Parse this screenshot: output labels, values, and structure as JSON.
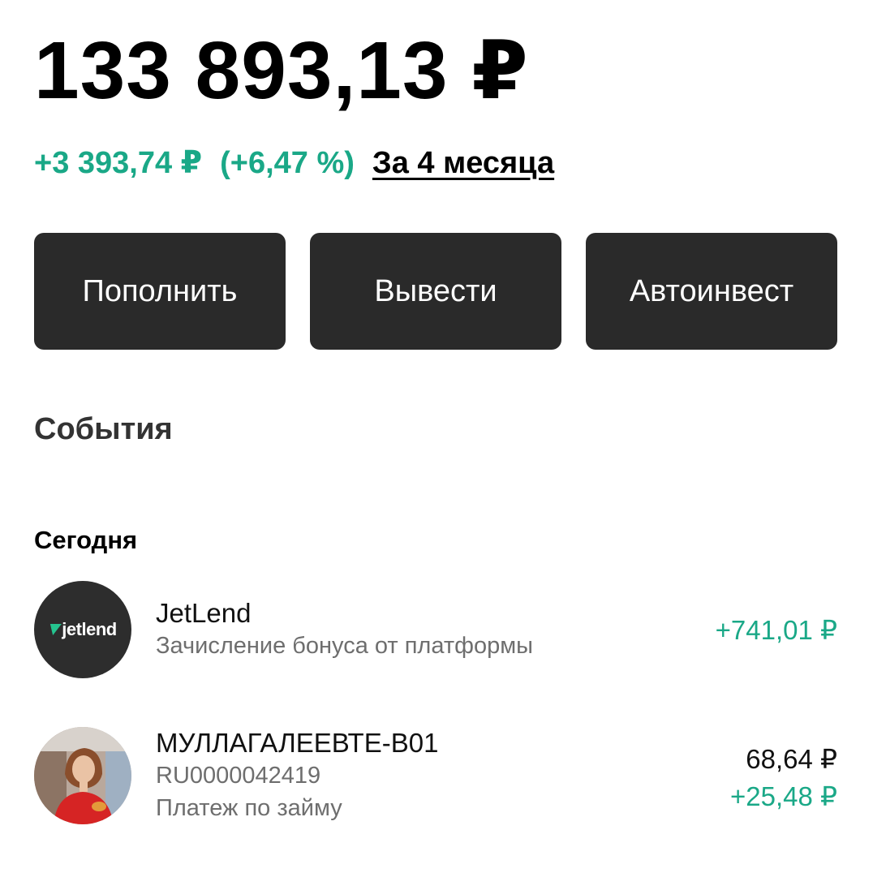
{
  "portfolio": {
    "balance": "133 893,13 ₽",
    "change_amount": "+3 393,74 ₽",
    "change_percent": "(+6,47 %)",
    "period_link": "За 4 месяца"
  },
  "actions": {
    "deposit_label": "Пополнить",
    "withdraw_label": "Вывести",
    "autoinvest_label": "Автоинвест"
  },
  "events": {
    "title": "События",
    "groups": [
      {
        "label": "Сегодня",
        "items": [
          {
            "avatar": "jetlend-logo",
            "logo_text": "jetlend",
            "name": "JetLend",
            "description": "Зачисление бонуса от платформы",
            "amount": "+741,01 ₽",
            "amount_color": "#1aa887"
          },
          {
            "avatar": "person-photo",
            "name": "МУЛЛАГАЛЕЕВТЕ-В01",
            "code": "RU0000042419",
            "description": "Платеж по займу",
            "amount_principal": "68,64 ₽",
            "amount_interest": "+25,48 ₽",
            "amount_color": "#1aa887"
          }
        ]
      }
    ]
  },
  "colors": {
    "accent_green": "#1aa887",
    "button_bg": "#2a2a2a"
  }
}
